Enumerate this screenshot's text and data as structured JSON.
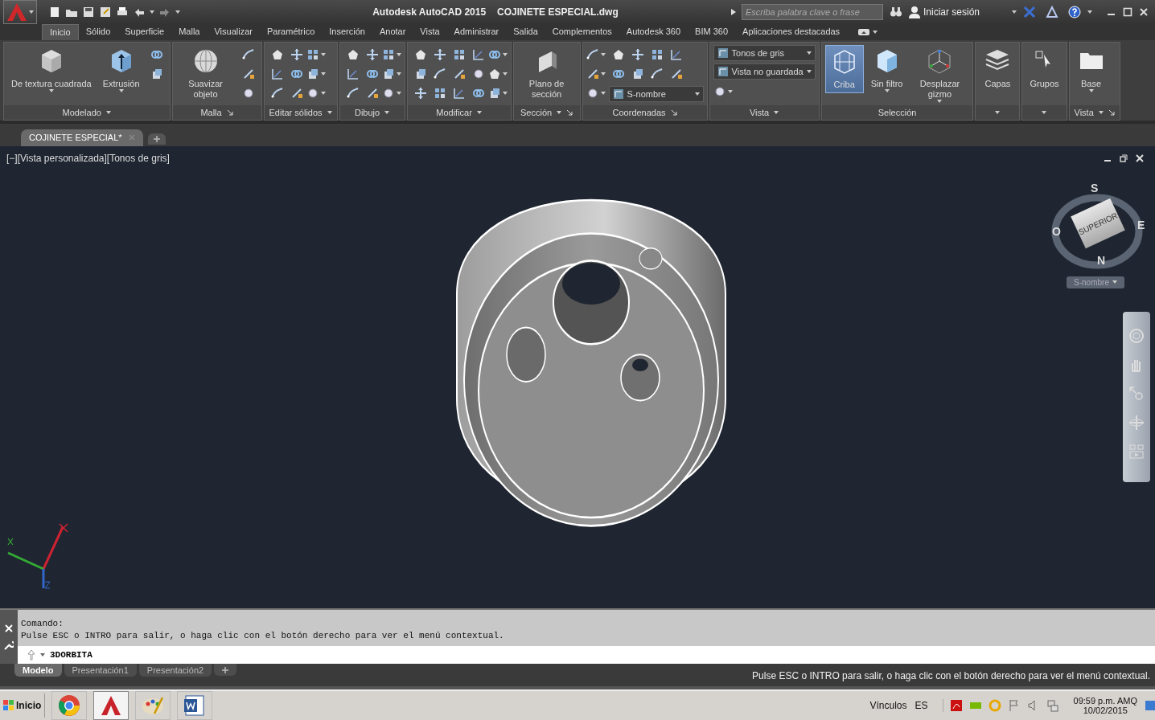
{
  "title_bar": {
    "app_name": "Autodesk AutoCAD 2015",
    "file_name": "COJINETE ESPECIAL.dwg",
    "search": {
      "placeholder": "Escriba palabra clave o frase"
    },
    "sign_in": "Iniciar sesión"
  },
  "ribbon_tabs": [
    {
      "label": "Inicio",
      "selected": true
    },
    {
      "label": "Sólido",
      "selected": false
    },
    {
      "label": "Superficie",
      "selected": false
    },
    {
      "label": "Malla",
      "selected": false
    },
    {
      "label": "Visualizar",
      "selected": false
    },
    {
      "label": "Paramétrico",
      "selected": false
    },
    {
      "label": "Inserción",
      "selected": false
    },
    {
      "label": "Anotar",
      "selected": false
    },
    {
      "label": "Vista",
      "selected": false
    },
    {
      "label": "Administrar",
      "selected": false
    },
    {
      "label": "Salida",
      "selected": false
    },
    {
      "label": "Complementos",
      "selected": false
    },
    {
      "label": "Autodesk 360",
      "selected": false
    },
    {
      "label": "BIM 360",
      "selected": false
    },
    {
      "label": "Aplicaciones destacadas",
      "selected": false
    }
  ],
  "ribbon_panels": [
    {
      "title": "Modelado",
      "menu": true,
      "launcher": false,
      "items": [
        {
          "kind": "big",
          "label": "De textura cuadrada",
          "dropdown": true,
          "on": false
        },
        {
          "kind": "big",
          "label": "Extrusión",
          "dropdown": true,
          "on": false
        },
        {
          "kind": "icons",
          "rows": [
            [
              {
                "kind": "tool"
              }
            ],
            [
              {
                "kind": "tool"
              }
            ]
          ]
        }
      ]
    },
    {
      "title": "Malla",
      "menu": false,
      "launcher": true,
      "items": [
        {
          "kind": "big_tall",
          "label": "Suavizar objeto",
          "dropdown": false,
          "on": false
        },
        {
          "kind": "icons",
          "rows": [
            [
              {
                "kind": "tool"
              }
            ],
            [
              {
                "kind": "tool"
              }
            ],
            [
              {
                "kind": "tool"
              }
            ]
          ]
        }
      ]
    },
    {
      "title": "Editar sólidos",
      "menu": true,
      "launcher": false,
      "items": [
        {
          "kind": "icons",
          "rows": [
            [
              {
                "kind": "tool"
              },
              {
                "kind": "tool"
              },
              {
                "kind": "tool_menu"
              }
            ],
            [
              {
                "kind": "tool"
              },
              {
                "kind": "tool"
              },
              {
                "kind": "tool_menu"
              }
            ],
            [
              {
                "kind": "tool"
              },
              {
                "kind": "tool"
              },
              {
                "kind": "tool_menu"
              }
            ]
          ]
        }
      ]
    },
    {
      "title": "Dibujo",
      "menu": true,
      "launcher": false,
      "items": [
        {
          "kind": "icons",
          "rows": [
            [
              {
                "kind": "tool"
              },
              {
                "kind": "tool"
              },
              {
                "kind": "tool_menu"
              }
            ],
            [
              {
                "kind": "tool"
              },
              {
                "kind": "tool"
              },
              {
                "kind": "tool_menu"
              }
            ],
            [
              {
                "kind": "tool"
              },
              {
                "kind": "tool"
              },
              {
                "kind": "tool_menu"
              }
            ]
          ]
        }
      ]
    },
    {
      "title": "Modificar",
      "menu": true,
      "launcher": false,
      "items": [
        {
          "kind": "icons",
          "rows": [
            [
              {
                "kind": "tool"
              },
              {
                "kind": "tool"
              },
              {
                "kind": "tool"
              },
              {
                "kind": "tool"
              },
              {
                "kind": "tool_menu"
              }
            ],
            [
              {
                "kind": "tool"
              },
              {
                "kind": "tool"
              },
              {
                "kind": "tool"
              },
              {
                "kind": "tool"
              },
              {
                "kind": "tool_menu"
              }
            ],
            [
              {
                "kind": "tool"
              },
              {
                "kind": "tool"
              },
              {
                "kind": "tool"
              },
              {
                "kind": "tool"
              },
              {
                "kind": "tool_menu"
              }
            ]
          ]
        }
      ]
    },
    {
      "title": "Sección",
      "menu": true,
      "launcher": true,
      "items": [
        {
          "kind": "big_tall",
          "label": "Plano de sección",
          "dropdown": false,
          "on": false
        }
      ]
    },
    {
      "title": "Coordenadas",
      "menu": false,
      "launcher": true,
      "items": [
        {
          "kind": "icons",
          "rows": [
            [
              {
                "kind": "tool_menu"
              }
            ],
            [
              {
                "kind": "tool_menu"
              }
            ],
            [
              {
                "kind": "tool_menu"
              }
            ]
          ]
        },
        {
          "kind": "column",
          "children": [
            {
              "kind": "icons",
              "rows": [
                [
                  {
                    "kind": "tool"
                  },
                  {
                    "kind": "tool"
                  },
                  {
                    "kind": "tool"
                  },
                  {
                    "kind": "tool"
                  }
                ],
                [
                  {
                    "kind": "tool"
                  },
                  {
                    "kind": "tool"
                  },
                  {
                    "kind": "tool"
                  },
                  {
                    "kind": "tool"
                  }
                ]
              ]
            },
            {
              "kind": "combo",
              "value": "S-nombre"
            }
          ]
        }
      ]
    },
    {
      "title": "Vista",
      "menu": true,
      "launcher": false,
      "items": [
        {
          "kind": "column",
          "children": [
            {
              "kind": "combo",
              "value": "Tonos de gris"
            },
            {
              "kind": "combo",
              "value": "Vista no guardada"
            },
            {
              "kind": "icons",
              "rows": [
                [
                  {
                    "kind": "tool_menu"
                  }
                ]
              ]
            }
          ]
        }
      ]
    },
    {
      "title": "Selección",
      "menu": false,
      "launcher": false,
      "items": [
        {
          "kind": "big",
          "label": "Criba",
          "dropdown": false,
          "on": true
        },
        {
          "kind": "big",
          "label": "Sin filtro",
          "dropdown": true,
          "on": false
        },
        {
          "kind": "big_tall",
          "label": "Desplazar gizmo",
          "dropdown": true,
          "on": false
        }
      ]
    },
    {
      "menu": true,
      "launcher": false,
      "items": [
        {
          "kind": "big",
          "label": "Capas",
          "dropdown": false,
          "on": false
        }
      ]
    },
    {
      "menu": true,
      "launcher": false,
      "items": [
        {
          "kind": "big",
          "label": "Grupos",
          "dropdown": false,
          "on": false
        }
      ]
    },
    {
      "title": "Vista",
      "menu": true,
      "launcher": true,
      "items": [
        {
          "kind": "big",
          "label": "Base",
          "dropdown": true,
          "on": false
        }
      ]
    }
  ],
  "document_tabs": [
    {
      "label": "COJINETE ESPECIAL*",
      "selected": true
    }
  ],
  "viewport": {
    "label": "[−][Vista personalizada][Tonos de gris]",
    "viewcube": {
      "top": "S",
      "right": "E",
      "left": "O",
      "bottom": "N",
      "face": "SUPERIOR",
      "ucs": "S-nombre"
    }
  },
  "command": {
    "history": [
      "Comando:",
      "Pulse ESC o INTRO para salir, o haga clic con el botón derecho para ver el menú contextual."
    ],
    "input": "3DORBITA"
  },
  "layout_tabs": [
    {
      "label": "Modelo",
      "selected": true
    },
    {
      "label": "Presentación1",
      "selected": false
    },
    {
      "label": "Presentación2",
      "selected": false
    }
  ],
  "status_message": "Pulse ESC o INTRO para salir, o haga clic con el botón derecho para ver el menú contextual.",
  "taskbar": {
    "start": "Inicio",
    "apps": [
      {
        "kind": "browser",
        "active": false
      },
      {
        "kind": "autocad",
        "active": true
      },
      {
        "kind": "paint",
        "active": false
      },
      {
        "kind": "word",
        "active": false
      }
    ],
    "links": "Vínculos",
    "language": "ES",
    "time": "09:59 p.m. AMQ",
    "date": "10/02/2015"
  }
}
